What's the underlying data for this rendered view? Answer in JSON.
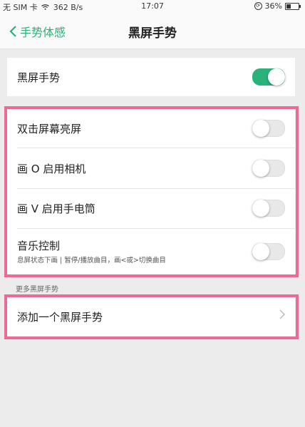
{
  "status_bar": {
    "carrier": "无 SIM 卡",
    "speed": "362 B/s",
    "time": "17:07",
    "battery": "36%",
    "battery_level": 0.36
  },
  "nav": {
    "back_label": "手势体感",
    "title": "黑屏手势"
  },
  "master": {
    "label": "黑屏手势",
    "enabled": true
  },
  "gestures": [
    {
      "label": "双击屏幕亮屏",
      "enabled": false
    },
    {
      "label": "画 O 启用相机",
      "enabled": false
    },
    {
      "label": "画 V 启用手电筒",
      "enabled": false
    },
    {
      "label": "音乐控制",
      "subtitle": "息屏状态下画 | 暂停/播放曲目，画<或>切换曲目",
      "enabled": false
    }
  ],
  "more": {
    "header": "更多黑屏手势",
    "add_label": "添加一个黑屏手势"
  },
  "colors": {
    "accent": "#2bb27a",
    "highlight": "#ec6a94"
  }
}
